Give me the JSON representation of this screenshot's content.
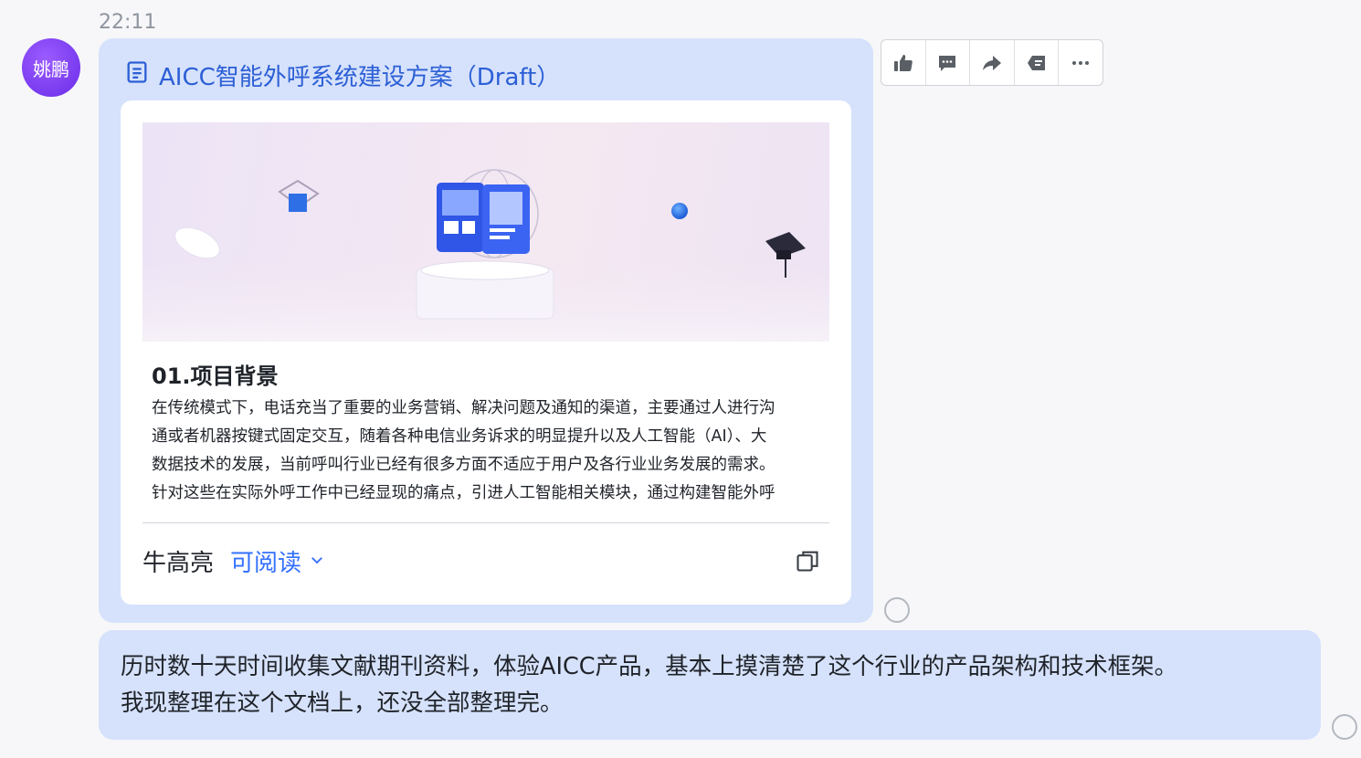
{
  "message": {
    "timestamp": "22:11",
    "sender_avatar_text": "姚鹏"
  },
  "doc_card": {
    "title": "AICC智能外呼系统建设方案（Draft）",
    "heading": "01.项目背景",
    "body_lines": [
      "在传统模式下，电话充当了重要的业务营销、解决问题及通知的渠道，主要通过人进行沟",
      "通或者机器按键式固定交互，随着各种电信业务诉求的明显提升以及人工智能（AI）、大",
      "数据技术的发展，当前呼叫行业已经有很多方面不适应于用户及各行业业务发展的需求。",
      "针对这些在实际外呼工作中已经显现的痛点，引进人工智能相关模块，通过构建智能外呼"
    ],
    "owner": "牛高亮",
    "permission": "可阅读"
  },
  "toolbar": {
    "icons": [
      "thumbs-up-icon",
      "reply-icon",
      "forward-icon",
      "quote-icon",
      "more-icon"
    ]
  },
  "text_message": {
    "lines": [
      "历时数十天时间收集文献期刊资料，体验AICC产品，基本上摸清楚了这个行业的产品架构和技术框架。",
      "我现整理在这个文档上，还没全部整理完。"
    ]
  },
  "colors": {
    "bubble": "#d6e2fb",
    "link": "#3370ff",
    "avatar": "#7b3ff2"
  }
}
